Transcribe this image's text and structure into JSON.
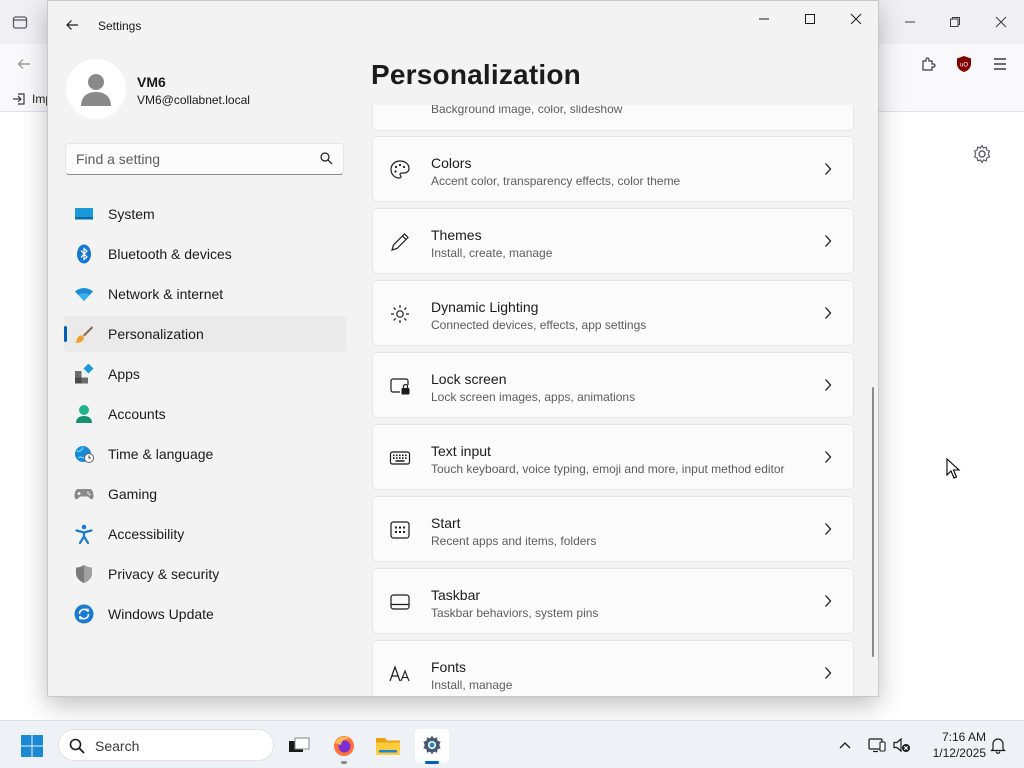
{
  "browser": {
    "bookmark_label": "Imp"
  },
  "settings": {
    "app_title": "Settings",
    "user": {
      "name": "VM6",
      "email": "VM6@collabnet.local"
    },
    "search": {
      "placeholder": "Find a setting"
    },
    "nav": [
      {
        "label": "System",
        "icon": "system-icon"
      },
      {
        "label": "Bluetooth & devices",
        "icon": "bluetooth-icon"
      },
      {
        "label": "Network & internet",
        "icon": "wifi-icon"
      },
      {
        "label": "Personalization",
        "icon": "brush-icon",
        "active": true
      },
      {
        "label": "Apps",
        "icon": "apps-icon"
      },
      {
        "label": "Accounts",
        "icon": "accounts-icon"
      },
      {
        "label": "Time & language",
        "icon": "globe-clock-icon"
      },
      {
        "label": "Gaming",
        "icon": "gamepad-icon"
      },
      {
        "label": "Accessibility",
        "icon": "accessibility-icon"
      },
      {
        "label": "Privacy & security",
        "icon": "shield-icon"
      },
      {
        "label": "Windows Update",
        "icon": "update-icon"
      }
    ],
    "page_title": "Personalization",
    "cards": [
      {
        "title": "",
        "subtitle": "Background image, color, slideshow",
        "icon": "background-icon"
      },
      {
        "title": "Colors",
        "subtitle": "Accent color, transparency effects, color theme",
        "icon": "palette-icon"
      },
      {
        "title": "Themes",
        "subtitle": "Install, create, manage",
        "icon": "pen-icon"
      },
      {
        "title": "Dynamic Lighting",
        "subtitle": "Connected devices, effects, app settings",
        "icon": "lighting-icon"
      },
      {
        "title": "Lock screen",
        "subtitle": "Lock screen images, apps, animations",
        "icon": "lock-screen-icon"
      },
      {
        "title": "Text input",
        "subtitle": "Touch keyboard, voice typing, emoji and more, input method editor",
        "icon": "keyboard-icon"
      },
      {
        "title": "Start",
        "subtitle": "Recent apps and items, folders",
        "icon": "start-icon"
      },
      {
        "title": "Taskbar",
        "subtitle": "Taskbar behaviors, system pins",
        "icon": "taskbar-icon"
      },
      {
        "title": "Fonts",
        "subtitle": "Install, manage",
        "icon": "fonts-icon"
      }
    ]
  },
  "taskbar": {
    "search_label": "Search",
    "time": "7:16 AM",
    "date": "1/12/2025"
  },
  "colors": {
    "accent": "#005fb8",
    "window_bg": "#f3f3f3",
    "card_bg": "#fbfbfb"
  }
}
